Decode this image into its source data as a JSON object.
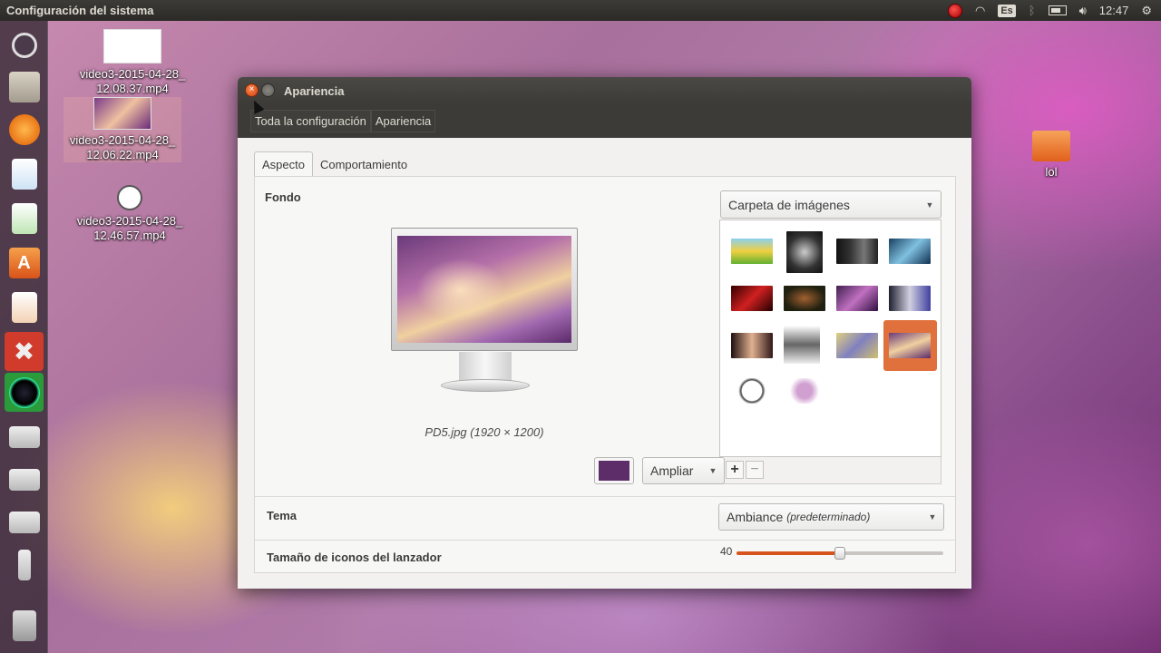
{
  "topbar": {
    "title": "Configuración del sistema",
    "keyboard": "Es",
    "time": "12:47"
  },
  "launcher": {
    "items": [
      "ubuntu-icon",
      "files-icon",
      "firefox-icon",
      "writer-icon",
      "calc-icon",
      "software-center-icon",
      "impress-icon",
      "settings-icon",
      "camera-icon",
      "drive-icon",
      "drive-icon",
      "drive-icon",
      "usb-icon",
      "trash-icon"
    ]
  },
  "desktop": {
    "icons": [
      {
        "label1": "video3-2015-04-28_",
        "label2": "12.08.37.mp4"
      },
      {
        "label1": "video3-2015-04-28_",
        "label2": "12.06.22.mp4"
      },
      {
        "label1": "video3-2015-04-28_",
        "label2": "12.46.57.mp4"
      },
      {
        "label1": "lol",
        "label2": ""
      }
    ]
  },
  "window": {
    "title": "Apariencia",
    "breadcrumbs": [
      "Toda la configuración",
      "Apariencia"
    ],
    "tabs": [
      "Aspecto",
      "Comportamiento"
    ],
    "fondo_label": "Fondo",
    "wallpaper_caption": "PD5.jpg (1920 × 1200)",
    "folder_combo": "Carpeta de imágenes",
    "zoom_combo": "Ampliar",
    "color_swatch": "#5c2d68",
    "tema_label": "Tema",
    "theme_value": "Ambiance",
    "theme_default": "(predeterminado)",
    "icon_size_label": "Tamaño de iconos del lanzador",
    "icon_size_value": "40",
    "icon_size_fraction": 0.5,
    "add_label": "+",
    "remove_label": "−",
    "selected_wallpaper_index": 11
  },
  "colors": {
    "accent": "#e0703c",
    "slider": "#d8541e",
    "titlebar": "#3c3b37"
  }
}
